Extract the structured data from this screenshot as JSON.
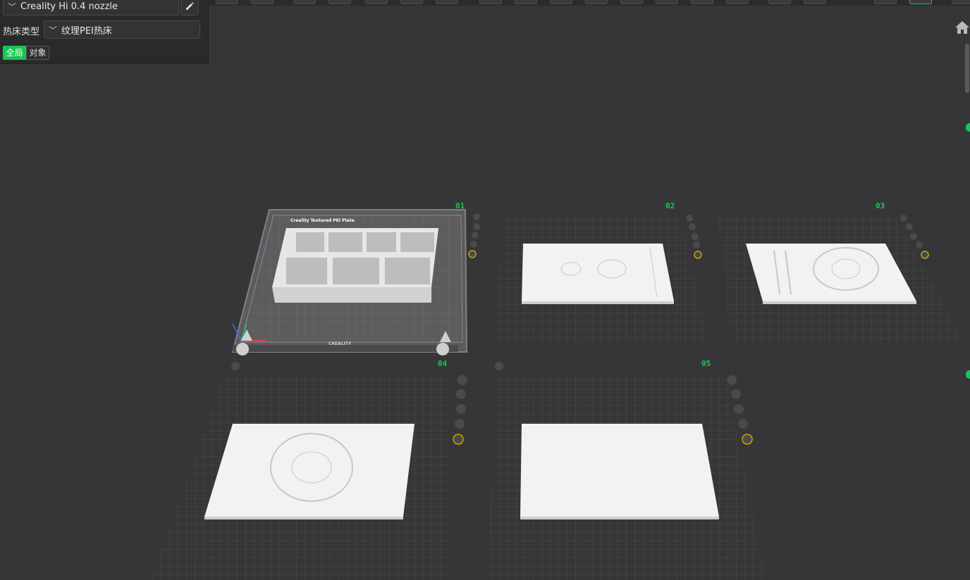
{
  "sidebar": {
    "printer": {
      "value": "Creality Hi 0.4 nozzle",
      "chevron_icon": "chevron-down-icon",
      "edit_icon": "pencil-icon"
    },
    "bed_type": {
      "label": "热床类型",
      "value": "纹理PEI热床",
      "chevron_icon": "chevron-down-icon"
    },
    "tabs": [
      {
        "label": "全局",
        "active": true
      },
      {
        "label": "对象",
        "active": false
      }
    ]
  },
  "viewport": {
    "home_icon": "home-icon",
    "plates": [
      {
        "number": "01",
        "bed_label": "Creality Textured PEI Plate",
        "brand": "CREALITY"
      },
      {
        "number": "02"
      },
      {
        "number": "03"
      },
      {
        "number": "04"
      },
      {
        "number": "05"
      }
    ]
  },
  "colors": {
    "accent": "#17c653",
    "background": "#363638",
    "panel": "#2a2a2c",
    "model": "#f2f2f2"
  }
}
